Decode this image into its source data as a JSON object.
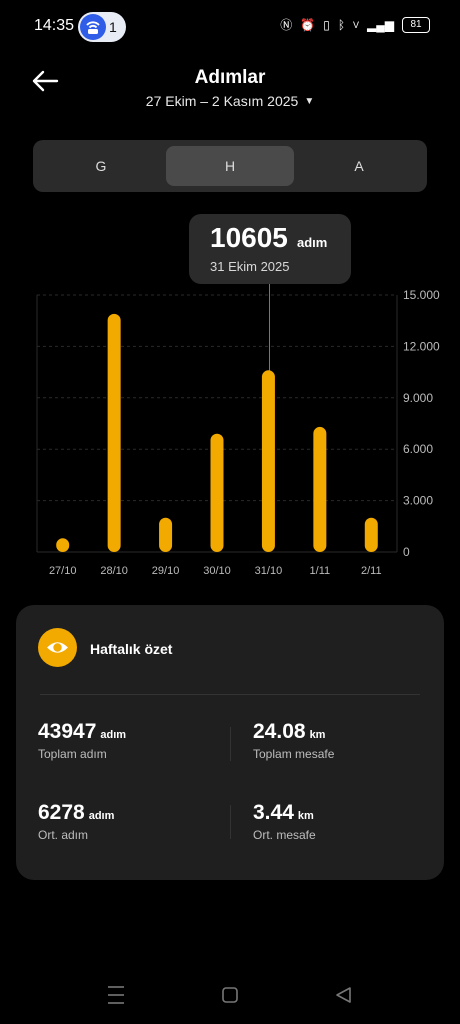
{
  "status": {
    "time": "14:35",
    "hotspot_count": "1",
    "battery": "81"
  },
  "header": {
    "title": "Adımlar",
    "range": "27 Ekim – 2 Kasım 2025"
  },
  "tabs": [
    {
      "label": "G"
    },
    {
      "label": "H",
      "active": true
    },
    {
      "label": "A"
    }
  ],
  "tooltip": {
    "value": "10605",
    "unit": "adım",
    "date": "31 Ekim 2025"
  },
  "chart_data": {
    "type": "bar",
    "categories": [
      "27/10",
      "28/10",
      "29/10",
      "30/10",
      "31/10",
      "1/11",
      "2/11"
    ],
    "values": [
      800,
      13900,
      2000,
      6900,
      10605,
      7300,
      2000
    ],
    "ylim": [
      0,
      15000
    ],
    "yticks": [
      "0",
      "3.000",
      "6.000",
      "9.000",
      "12.000",
      "15.000"
    ],
    "ytick_values": [
      0,
      3000,
      6000,
      9000,
      12000,
      15000
    ],
    "selected_index": 4,
    "bar_color": "#f2a900",
    "grid": true
  },
  "summary": {
    "title": "Haftalık özet",
    "total_steps": {
      "value": "43947",
      "unit": "adım",
      "label": "Toplam adım"
    },
    "total_distance": {
      "value": "24.08",
      "unit": "km",
      "label": "Toplam mesafe"
    },
    "avg_steps": {
      "value": "6278",
      "unit": "adım",
      "label": "Ort. adım"
    },
    "avg_distance": {
      "value": "3.44",
      "unit": "km",
      "label": "Ort. mesafe"
    }
  },
  "colors": {
    "accent": "#f2a900",
    "card": "#1f1f1f",
    "background": "#000000"
  }
}
